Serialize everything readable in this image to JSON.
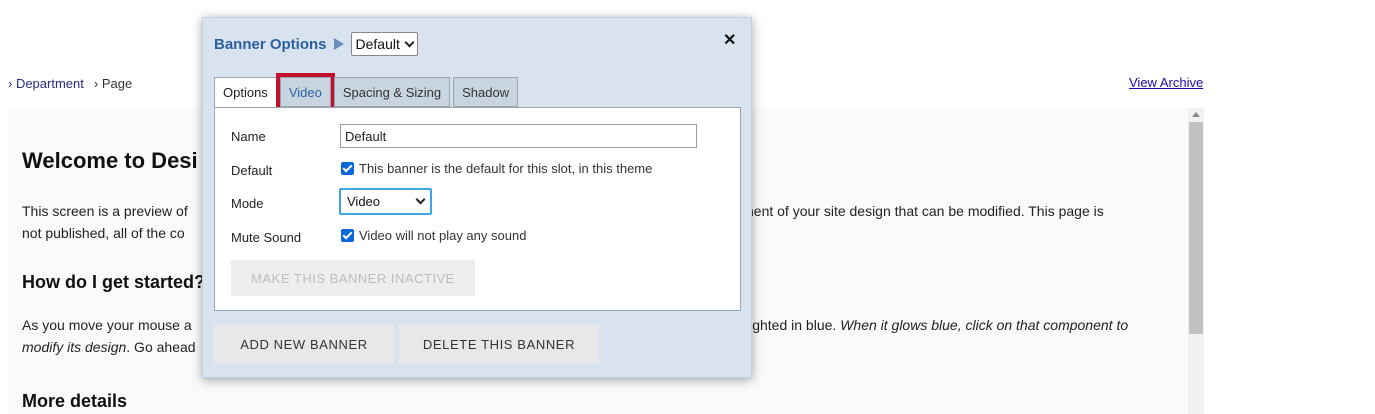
{
  "breadcrumb": {
    "items": [
      "› Department",
      "› Page"
    ]
  },
  "view_archive": "View Archive",
  "content": {
    "heading": "Welcome to Desi",
    "para1_line1": "This screen is a preview of",
    "para1_line1_right": "nent of your site design that can be modified. This page is",
    "para1_line2": "not published, all of the co",
    "subheading1": "How do I get started?",
    "para2_line1": "As you move your mouse a",
    "para2_line1_right_plain": "lighted in blue. ",
    "para2_line1_right_italic": "When it glows blue, click on that component to",
    "para2_line2_italic": "modify its design",
    "para2_line2_plain": ". Go ahead",
    "subheading2": "More details"
  },
  "dialog": {
    "title": "Banner Options",
    "banner_select_value": "Default",
    "close_label": "✕",
    "tabs": [
      {
        "label": "Options"
      },
      {
        "label": "Video"
      },
      {
        "label": "Spacing & Sizing"
      },
      {
        "label": "Shadow"
      }
    ],
    "fields": {
      "name_label": "Name",
      "name_value": "Default",
      "default_label": "Default",
      "default_check_text": "This banner is the default for this slot, in this theme",
      "mode_label": "Mode",
      "mode_value": "Video",
      "mute_label": "Mute Sound",
      "mute_check_text": "Video will not play any sound"
    },
    "inactive_button": "MAKE THIS BANNER INACTIVE",
    "add_button": "ADD NEW BANNER",
    "delete_button": "DELETE THIS BANNER"
  },
  "colors": {
    "dialog_bg": "#d9e3ef",
    "title": "#2b5f9e",
    "highlight": "#c0102a",
    "checkbox": "#0a67d8",
    "focus": "#3da6e0"
  }
}
